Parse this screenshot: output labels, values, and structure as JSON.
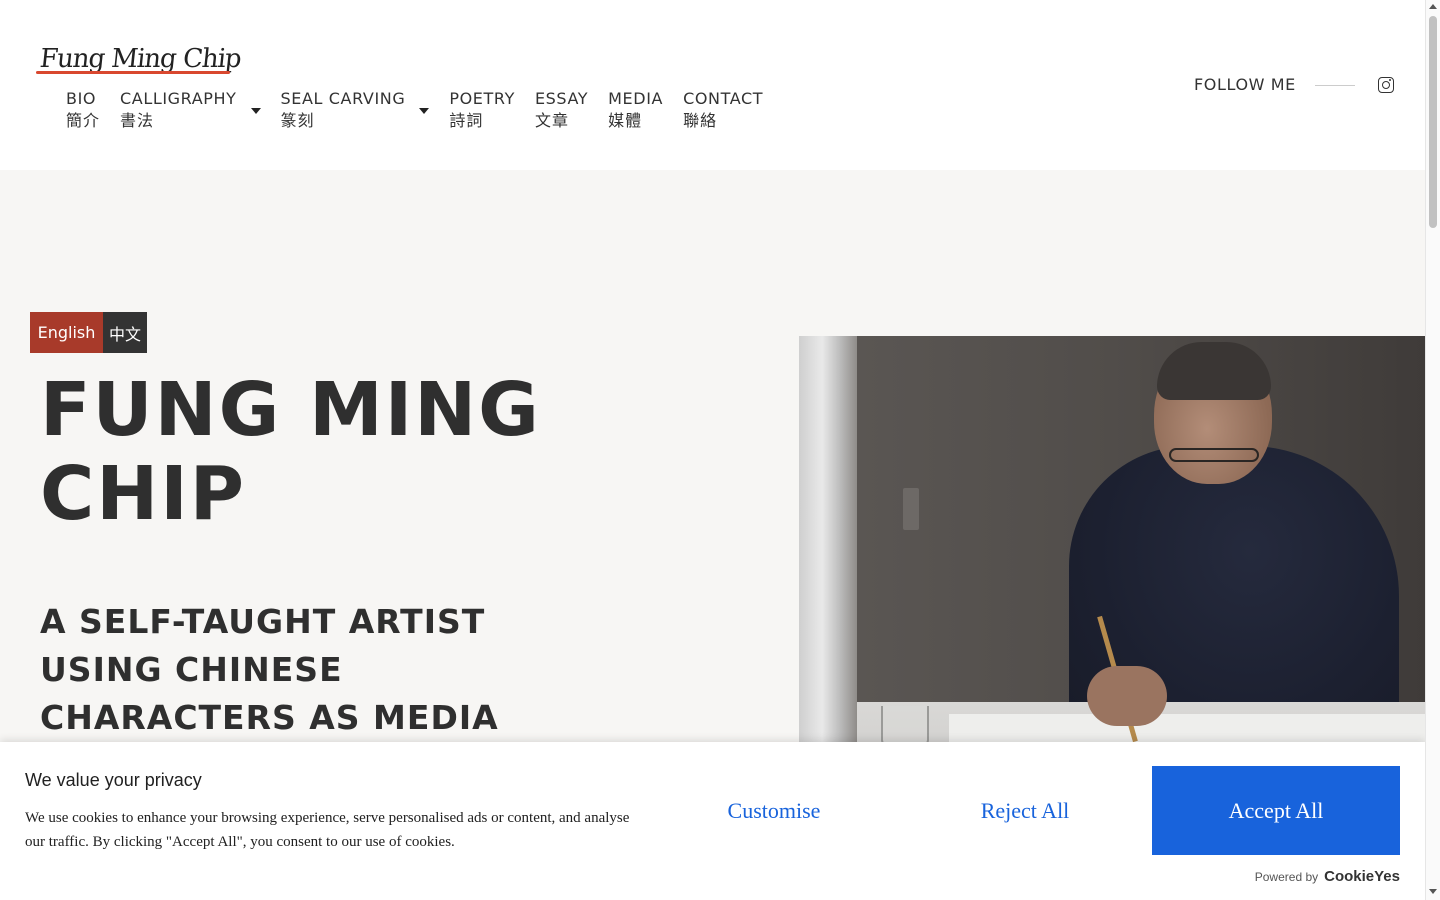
{
  "header": {
    "logo_text": "Fung Ming Chip",
    "nav": [
      {
        "label": "BIO",
        "label_zh": "簡介",
        "has_dropdown": false
      },
      {
        "label": "CALLIGRAPHY",
        "label_zh": "書法",
        "has_dropdown": true
      },
      {
        "label": "SEAL CARVING",
        "label_zh": "篆刻",
        "has_dropdown": true
      },
      {
        "label": "POETRY",
        "label_zh": "詩詞",
        "has_dropdown": false
      },
      {
        "label": "ESSAY",
        "label_zh": "文章",
        "has_dropdown": false
      },
      {
        "label": "MEDIA",
        "label_zh": "媒體",
        "has_dropdown": false
      },
      {
        "label": "CONTACT",
        "label_zh": "聯絡",
        "has_dropdown": false
      }
    ],
    "follow_label": "FOLLOW ME",
    "social_icon": "instagram-icon"
  },
  "hero": {
    "lang_en": "English",
    "lang_zh": "中文",
    "title": "Fung Ming Chip",
    "subtitle": "A self-taught artist using Chinese characters as media"
  },
  "cookie": {
    "title": "We value your privacy",
    "text": "We use cookies to enhance your browsing experience, serve personalised ads or content, and analyse our traffic. By clicking \"Accept All\", you consent to our use of cookies.",
    "customise": "Customise",
    "reject": "Reject All",
    "accept": "Accept All",
    "powered_by": "Powered by",
    "brand": "CookieYes"
  },
  "colors": {
    "accent_red": "#a83a2a",
    "logo_underline": "#d9482f",
    "cookie_blue": "#1863dc",
    "hero_bg": "#f7f6f4"
  }
}
